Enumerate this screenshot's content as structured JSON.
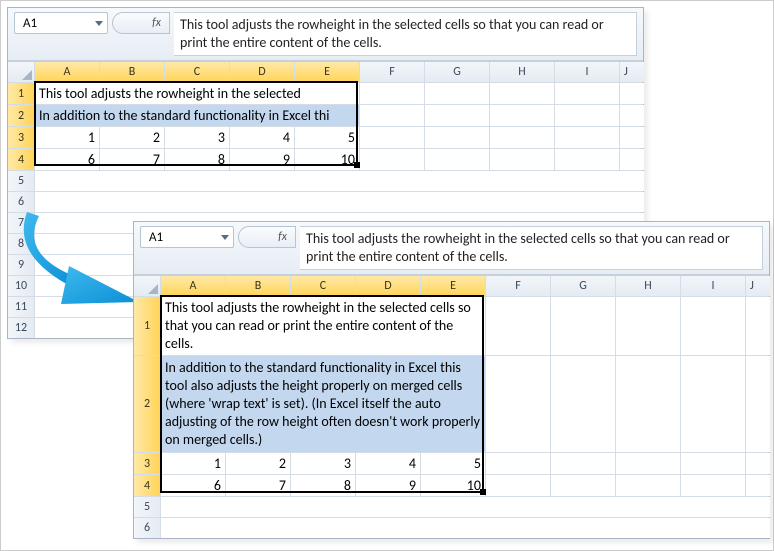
{
  "top": {
    "nameBox": "A1",
    "formulaBar": "This tool adjusts the rowheight in the selected cells so that you can read or print the entire content of the cells.",
    "cols": [
      "A",
      "B",
      "C",
      "D",
      "E",
      "F",
      "G",
      "H",
      "I",
      "J"
    ],
    "rows": [
      "1",
      "2",
      "3",
      "4",
      "5",
      "6",
      "7",
      "8",
      "9",
      "10",
      "11",
      "12"
    ],
    "row1Merged": "This tool adjusts the rowheight in the selected",
    "row2Merged": "In addition to the standard functionality in Excel thi",
    "r3": [
      "1",
      "2",
      "3",
      "4",
      "5"
    ],
    "r4": [
      "6",
      "7",
      "8",
      "9",
      "10"
    ]
  },
  "bottom": {
    "nameBox": "A1",
    "formulaBar": "This tool adjusts the rowheight in the selected cells so that you can read or print the entire content of the cells.",
    "cols": [
      "A",
      "B",
      "C",
      "D",
      "E",
      "F",
      "G",
      "H",
      "I",
      "J"
    ],
    "rows": [
      "1",
      "2",
      "3",
      "4",
      "5",
      "6"
    ],
    "row1Merged": "This tool adjusts the rowheight in the selected cells so that you can read or print the entire content of the cells.",
    "row2Merged": "In addition to the standard functionality in Excel this tool also adjusts the height properly on merged cells (where 'wrap text' is set). (In Excel itself the auto adjusting of the row height often doesn't work properly on merged cells.)",
    "r3": [
      "1",
      "2",
      "3",
      "4",
      "5"
    ],
    "r4": [
      "6",
      "7",
      "8",
      "9",
      "10"
    ]
  }
}
